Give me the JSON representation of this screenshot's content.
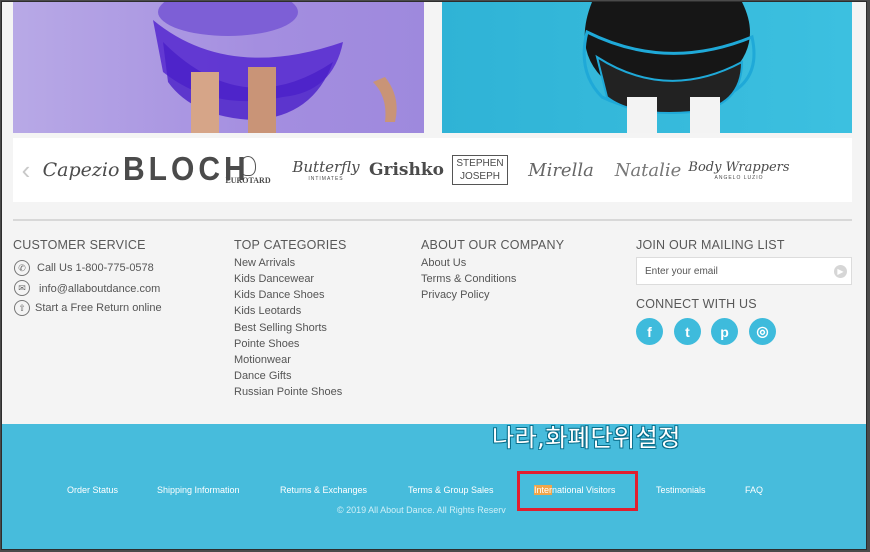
{
  "brands": {
    "prev_icon": "chevron-left-icon",
    "items": [
      "Capezio",
      "BLOCH",
      "EUROTARD",
      "Butterfly",
      "Grishko",
      "STEPHEN JOSEPH",
      "Mirella",
      "Natalie",
      "Body Wrappers"
    ],
    "subtitles": {
      "butterfly": "INTIMATES",
      "bodywrappers": "ANGELO LUZIO"
    }
  },
  "customer_service": {
    "title": "CUSTOMER SERVICE",
    "phone": "Call Us 1-800-775-0578",
    "email": "info@allaboutdance.com",
    "return": "Start a Free Return online"
  },
  "top_categories": {
    "title": "TOP CATEGORIES",
    "items": [
      "New Arrivals",
      "Kids Dancewear",
      "Kids Dance Shoes",
      "Kids Leotards",
      "Best Selling Shorts",
      "Pointe Shoes",
      "Motionwear",
      "Dance Gifts",
      "Russian Pointe Shoes"
    ]
  },
  "about": {
    "title": "ABOUT OUR COMPANY",
    "items": [
      "About Us",
      "Terms & Conditions",
      "Privacy Policy"
    ]
  },
  "mailing": {
    "title": "JOIN OUR MAILING LIST",
    "placeholder": "Enter your email"
  },
  "connect": {
    "title": "CONNECT WITH US",
    "icons": [
      "facebook-icon",
      "twitter-icon",
      "pinterest-icon",
      "instagram-icon"
    ],
    "glyphs": [
      "f",
      "t",
      "p",
      "◎"
    ]
  },
  "footer_nav": {
    "order_status": "Order Status",
    "shipping": "Shipping Information",
    "returns": "Returns & Exchanges",
    "terms_group": "Terms & Group Sales",
    "international_hl": "Inter",
    "international_rest": "national Visitors",
    "testimonials": "Testimonials",
    "faq": "FAQ"
  },
  "copyright": "© 2019 All About Dance. All Rights Reserv",
  "annotation": {
    "korean_text": "나라,화폐단위설정"
  },
  "colors": {
    "accent": "#47bcdc",
    "highlight_border": "#e01f2f",
    "text_highlight": "#f0a64a"
  }
}
